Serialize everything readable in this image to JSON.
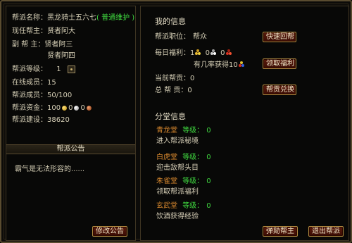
{
  "left": {
    "guild_name_label": "帮派名称：",
    "guild_name": "黑龙骑士五六七",
    "guild_status": "( 普通维护 )",
    "leader_label": "现任帮主：",
    "leader": "贤者阿大",
    "vice_label": "副 帮 主：",
    "vice_1": "贤者阿三",
    "vice_2": "贤者阿四",
    "level_label": "帮派等级：",
    "level": "1",
    "online_label": "在线成员：",
    "online": "15",
    "members_label": "帮派成员：",
    "members": "50/100",
    "funds_label": "帮派资金：",
    "funds_gold": "100",
    "funds_silver": "0",
    "funds_copper": "0",
    "build_label": "帮派建设：",
    "build": "38620",
    "notice_title": "帮派公告",
    "notice_text": "霸气是无法形容的......",
    "edit_notice_button": "修改公告"
  },
  "right": {
    "my_info_title": "我的信息",
    "position_label": "帮派职位：",
    "position": "帮众",
    "quick_return_button": "快速回帮",
    "daily_label": "每日福利：",
    "daily_a": "1",
    "daily_b": "0",
    "daily_c": "0",
    "daily_line2_prefix": "有几率获得10",
    "claim_button": "领取福利",
    "current_contrib_label": "当前帮贡：",
    "current_contrib": "0",
    "total_contrib_label": "总  帮  贡：",
    "total_contrib": "0",
    "exchange_button": "帮贡兑换",
    "branch_title": "分堂信息",
    "halls": [
      {
        "name": "青龙堂",
        "level_label": "等级：",
        "level": "0",
        "desc": "进入帮派秘境"
      },
      {
        "name": "白虎堂",
        "level_label": "等级：",
        "level": "0",
        "desc": "迎击敌帮头目"
      },
      {
        "name": "朱雀堂",
        "level_label": "等级：",
        "level": "0",
        "desc": "领取帮派福利"
      },
      {
        "name": "玄武堂",
        "level_label": "等级：",
        "level": "0",
        "desc": "饮酒获得经验"
      }
    ],
    "impeach_button": "弹劾帮主",
    "leave_button": "退出帮派"
  }
}
